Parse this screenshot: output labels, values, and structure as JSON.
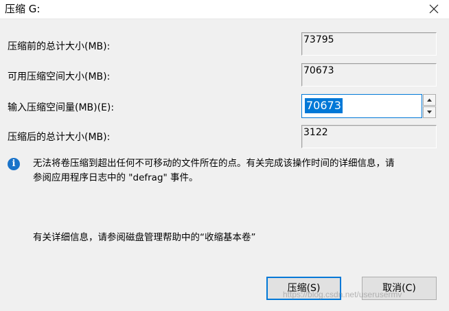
{
  "window": {
    "title": "压缩 G:",
    "close_icon": "close-icon"
  },
  "fields": {
    "total_before": {
      "label": "压缩前的总计大小(MB):",
      "value": "73795"
    },
    "available": {
      "label": "可用压缩空间大小(MB):",
      "value": "70673"
    },
    "input_amount": {
      "label": "输入压缩空间量(MB)(E):",
      "value": "70673"
    },
    "total_after": {
      "label": "压缩后的总计大小(MB):",
      "value": "3122"
    }
  },
  "info": {
    "icon": "info-icon",
    "line1": "无法将卷压缩到超出任何不可移动的文件所在的点。有关完成该操作时间的详细信息，请",
    "line2": "参阅应用程序日志中的 \"defrag\" 事件。",
    "help": "有关详细信息，请参阅磁盘管理帮助中的“收缩基本卷”"
  },
  "buttons": {
    "shrink": "压缩(S)",
    "cancel": "取消(C)"
  },
  "watermark": "https://blog.csdn.net/userusermv",
  "colors": {
    "accent": "#0078d7",
    "info_icon": "#1a73c9",
    "background": "#f0f0f0"
  }
}
